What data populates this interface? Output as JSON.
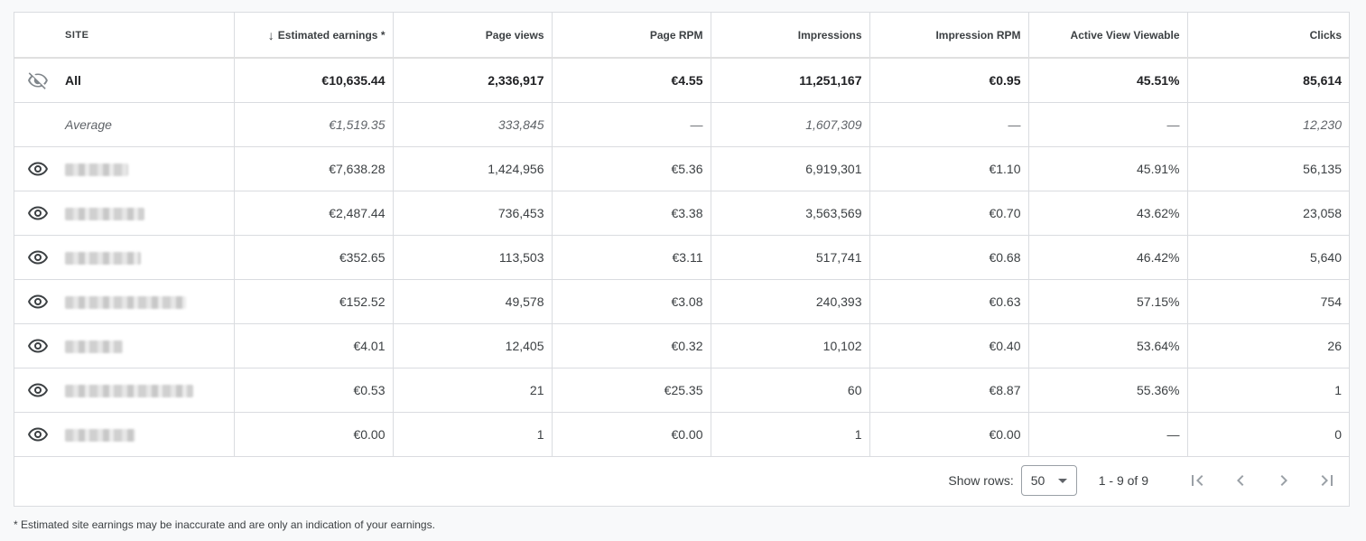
{
  "table": {
    "headers": {
      "site": "SITE",
      "earnings": "Estimated earnings *",
      "page_views": "Page views",
      "page_rpm": "Page RPM",
      "impressions": "Impressions",
      "impression_rpm": "Impression RPM",
      "active_view": "Active View Viewable",
      "clicks": "Clicks"
    },
    "sort_icon": "arrow-down-icon",
    "all": {
      "label": "All",
      "icon": "eye-off-icon",
      "earnings": "€10,635.44",
      "page_views": "2,336,917",
      "page_rpm": "€4.55",
      "impressions": "11,251,167",
      "impression_rpm": "€0.95",
      "active_view": "45.51%",
      "clicks": "85,614"
    },
    "average": {
      "label": "Average",
      "earnings": "€1,519.35",
      "page_views": "333,845",
      "page_rpm": "—",
      "impressions": "1,607,309",
      "impression_rpm": "—",
      "active_view": "—",
      "clicks": "12,230"
    },
    "rows": [
      {
        "icon": "eye-icon",
        "earnings": "€7,638.28",
        "page_views": "1,424,956",
        "page_rpm": "€5.36",
        "impressions": "6,919,301",
        "impression_rpm": "€1.10",
        "active_view": "45.91%",
        "clicks": "56,135"
      },
      {
        "icon": "eye-icon",
        "earnings": "€2,487.44",
        "page_views": "736,453",
        "page_rpm": "€3.38",
        "impressions": "3,563,569",
        "impression_rpm": "€0.70",
        "active_view": "43.62%",
        "clicks": "23,058"
      },
      {
        "icon": "eye-icon",
        "earnings": "€352.65",
        "page_views": "113,503",
        "page_rpm": "€3.11",
        "impressions": "517,741",
        "impression_rpm": "€0.68",
        "active_view": "46.42%",
        "clicks": "5,640"
      },
      {
        "icon": "eye-icon",
        "earnings": "€152.52",
        "page_views": "49,578",
        "page_rpm": "€3.08",
        "impressions": "240,393",
        "impression_rpm": "€0.63",
        "active_view": "57.15%",
        "clicks": "754"
      },
      {
        "icon": "eye-icon",
        "earnings": "€4.01",
        "page_views": "12,405",
        "page_rpm": "€0.32",
        "impressions": "10,102",
        "impression_rpm": "€0.40",
        "active_view": "53.64%",
        "clicks": "26"
      },
      {
        "icon": "eye-icon",
        "earnings": "€0.53",
        "page_views": "21",
        "page_rpm": "€25.35",
        "impressions": "60",
        "impression_rpm": "€8.87",
        "active_view": "55.36%",
        "clicks": "1"
      },
      {
        "icon": "eye-icon",
        "earnings": "€0.00",
        "page_views": "1",
        "page_rpm": "€0.00",
        "impressions": "1",
        "impression_rpm": "€0.00",
        "active_view": "—",
        "clicks": "0"
      }
    ]
  },
  "pagination": {
    "show_rows_label": "Show rows:",
    "rows_value": "50",
    "range": "1 - 9 of 9",
    "icons": [
      "first-page-icon",
      "prev-page-icon",
      "next-page-icon",
      "last-page-icon"
    ]
  },
  "footnote": "* Estimated site earnings may be inaccurate and are only an indication of your earnings."
}
